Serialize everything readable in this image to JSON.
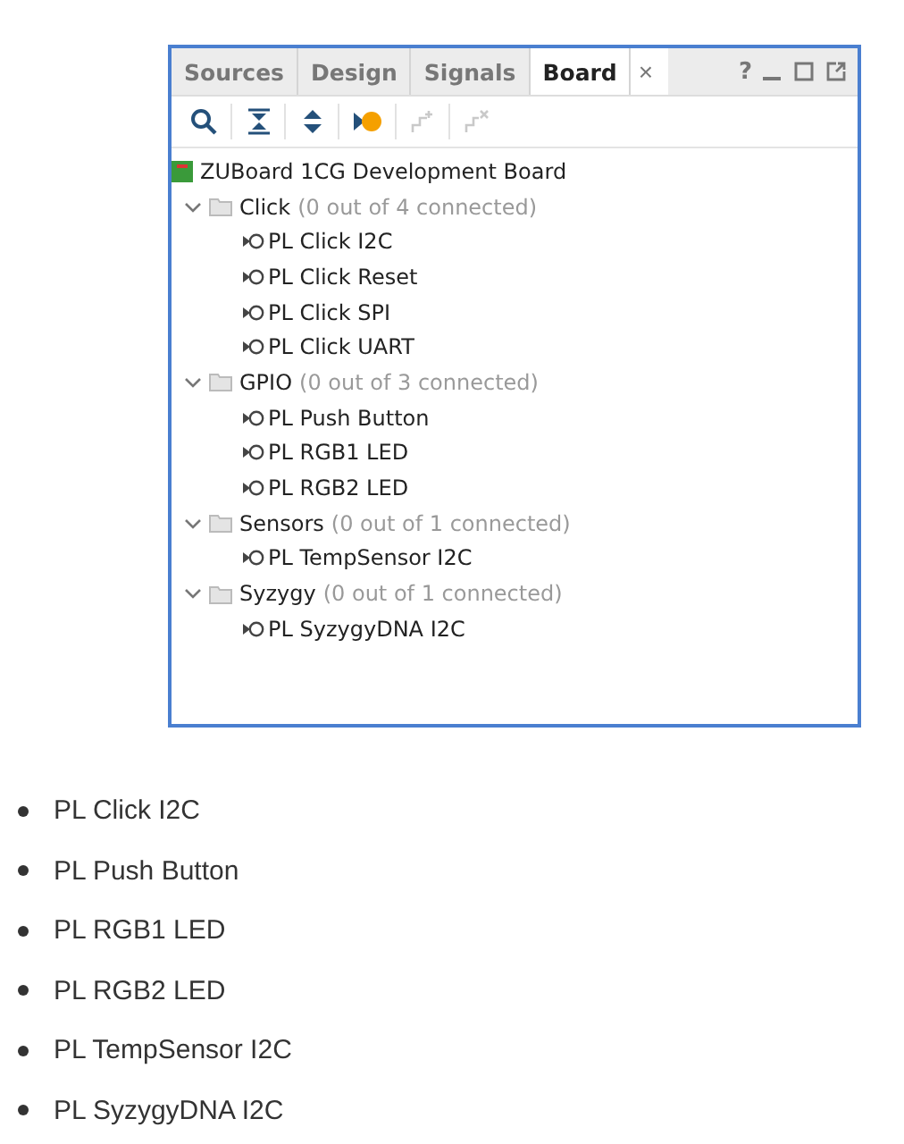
{
  "panel": {
    "tabs": [
      {
        "label": "Sources",
        "selected": false
      },
      {
        "label": "Design",
        "selected": false
      },
      {
        "label": "Signals",
        "selected": false
      },
      {
        "label": "Board",
        "selected": true
      }
    ],
    "close_tab": "×",
    "help": "?",
    "toolbar": [
      {
        "disabled": false
      },
      {
        "disabled": false
      },
      {
        "disabled": false
      },
      {
        "disabled": false
      },
      {
        "disabled": true
      },
      {
        "disabled": true
      }
    ],
    "tree": {
      "label": "ZUBoard 1CG Development Board",
      "children": [
        {
          "label": "Click",
          "count": "(0 out of 4 connected)",
          "expanded": true,
          "children": [
            "PL Click I2C",
            "PL Click Reset",
            "PL Click SPI",
            "PL Click UART"
          ]
        },
        {
          "label": "GPIO",
          "count": "(0 out of 3 connected)",
          "expanded": true,
          "children": [
            "PL Push Button",
            "PL RGB1 LED",
            "PL RGB2 LED"
          ]
        },
        {
          "label": "Sensors",
          "count": "(0 out of 1 connected)",
          "expanded": true,
          "children": [
            "PL TempSensor I2C"
          ]
        },
        {
          "label": "Syzygy",
          "count": "(0 out of 1 connected)",
          "expanded": true,
          "children": [
            "PL SyzygyDNA I2C"
          ]
        }
      ]
    }
  },
  "bullets": [
    "PL Click I2C",
    "PL Push Button",
    "PL RGB1 LED",
    "PL RGB2 LED",
    "PL TempSensor I2C",
    "PL SyzygyDNA I2C"
  ]
}
